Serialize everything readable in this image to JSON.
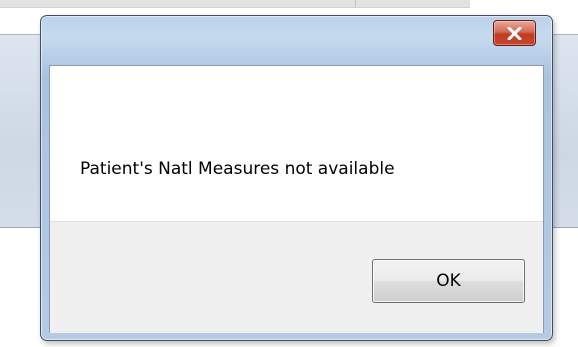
{
  "dialog": {
    "message": "Patient's Natl Measures not available",
    "ok_label": "OK",
    "close_icon": "close-icon"
  },
  "colors": {
    "close_button": "#c8452d",
    "window_frame": "#b5cbe4",
    "footer": "#f0f0f0"
  }
}
